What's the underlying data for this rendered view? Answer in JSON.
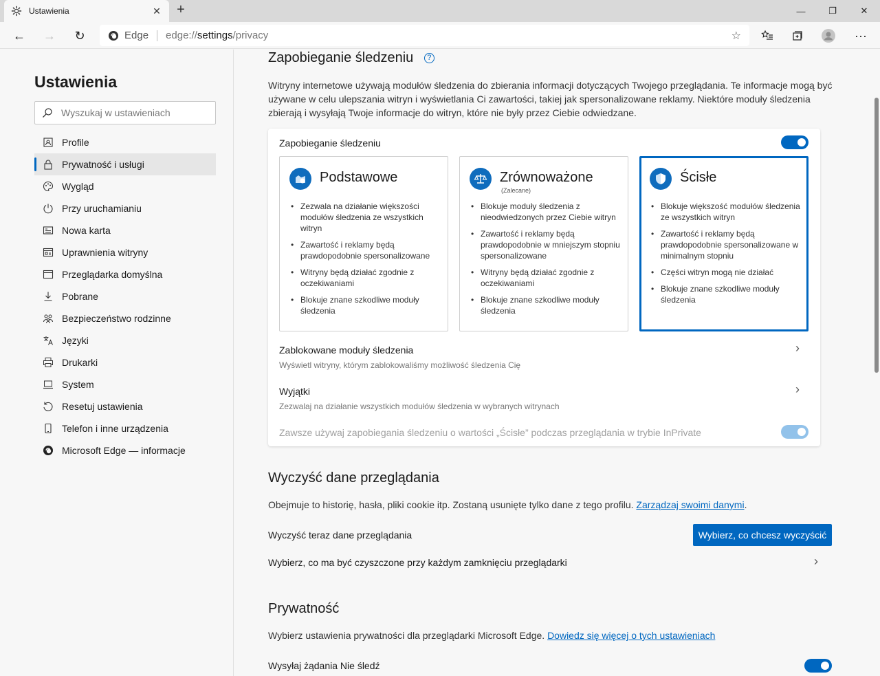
{
  "window": {
    "tab_title": "Ustawienia",
    "tab_icon": "gear-icon",
    "close_tab": "✕",
    "new_tab": "+",
    "minimize": "—",
    "restore": "❐",
    "close": "✕"
  },
  "navbar": {
    "back": "←",
    "forward": "→",
    "refresh": "↻",
    "edge_label": "Edge",
    "url_scheme": "edge://",
    "url_host": "settings",
    "url_path": "/privacy",
    "favorite": "☆",
    "more": "···"
  },
  "sidebar": {
    "title": "Ustawienia",
    "search_placeholder": "Wyszukaj w ustawieniach",
    "items": [
      {
        "label": "Profile",
        "icon": "profile-icon"
      },
      {
        "label": "Prywatność i usługi",
        "icon": "lock-icon",
        "active": true
      },
      {
        "label": "Wygląd",
        "icon": "palette-icon"
      },
      {
        "label": "Przy uruchamianiu",
        "icon": "power-icon"
      },
      {
        "label": "Nowa karta",
        "icon": "new-tab-icon"
      },
      {
        "label": "Uprawnienia witryny",
        "icon": "site-permissions-icon"
      },
      {
        "label": "Przeglądarka domyślna",
        "icon": "browser-icon"
      },
      {
        "label": "Pobrane",
        "icon": "download-icon"
      },
      {
        "label": "Bezpieczeństwo rodzinne",
        "icon": "family-icon"
      },
      {
        "label": "Języki",
        "icon": "languages-icon"
      },
      {
        "label": "Drukarki",
        "icon": "printer-icon"
      },
      {
        "label": "System",
        "icon": "system-icon"
      },
      {
        "label": "Resetuj ustawienia",
        "icon": "reset-icon"
      },
      {
        "label": "Telefon i inne urządzenia",
        "icon": "phone-icon"
      },
      {
        "label": "Microsoft Edge — informacje",
        "icon": "edge-logo-icon"
      }
    ]
  },
  "tracking": {
    "heading": "Zapobieganie śledzeniu",
    "help": "?",
    "description": "Witryny internetowe używają modułów śledzenia do zbierania informacji dotyczących Twojego przeglądania. Te informacje mogą być używane w celu ulepszania witryn i wyświetlania Ci zawartości, takiej jak spersonalizowane reklamy. Niektóre moduły śledzenia zbierają i wysyłają Twoje informacje do witryn, które nie były przez Ciebie odwiedzane.",
    "toggle_label": "Zapobieganie śledzeniu",
    "enabled": true,
    "options": [
      {
        "title": "Podstawowe",
        "icon": "basic-icon",
        "recommended": "",
        "bullets": [
          "Zezwala na działanie większości modułów śledzenia ze wszystkich witryn",
          "Zawartość i reklamy będą prawdopodobnie spersonalizowane",
          "Witryny będą działać zgodnie z oczekiwaniami",
          "Blokuje znane szkodliwe moduły śledzenia"
        ]
      },
      {
        "title": "Zrównoważone",
        "icon": "scale-icon",
        "recommended": "(Zalecane)",
        "bullets": [
          "Blokuje moduły śledzenia z nieodwiedzonych przez Ciebie witryn",
          "Zawartość i reklamy będą prawdopodobnie w mniejszym stopniu spersonalizowane",
          "Witryny będą działać zgodnie z oczekiwaniami",
          "Blokuje znane szkodliwe moduły śledzenia"
        ]
      },
      {
        "title": "Ścisłe",
        "icon": "shield-icon",
        "recommended": "",
        "selected": true,
        "bullets": [
          "Blokuje większość modułów śledzenia ze wszystkich witryn",
          "Zawartość i reklamy będą prawdopodobnie spersonalizowane w minimalnym stopniu",
          "Części witryn mogą nie działać",
          "Blokuje znane szkodliwe moduły śledzenia"
        ]
      }
    ],
    "blocked_title": "Zablokowane moduły śledzenia",
    "blocked_sub": "Wyświetl witryny, którym zablokowaliśmy możliwość śledzenia Cię",
    "exceptions_title": "Wyjątki",
    "exceptions_sub": "Zezwalaj na działanie wszystkich modułów śledzenia w wybranych witrynach",
    "inprivate_label": "Zawsze używaj zapobiegania śledzeniu o wartości „Ścisłe” podczas przeglądania w trybie InPrivate",
    "chevron": "›"
  },
  "clear": {
    "heading": "Wyczyść dane przeglądania",
    "description": "Obejmuje to historię, hasła, pliki cookie itp. Zostaną usunięte tylko dane z tego profilu.",
    "manage_link": "Zarządzaj swoimi danymi",
    "period": ".",
    "clear_now_label": "Wyczyść teraz dane przeglądania",
    "clear_button": "Wybierz, co chcesz wyczyścić",
    "on_close_label": "Wybierz, co ma być czyszczone przy każdym zamknięciu przeglądarki"
  },
  "privacy": {
    "heading": "Prywatność",
    "description": "Wybierz ustawienia prywatności dla przeglądarki Microsoft Edge.",
    "learn_link": "Dowiedz się więcej o tych ustawieniach",
    "dnt_label": "Wysyłaj żądania Nie śledź",
    "dnt_enabled": true
  }
}
